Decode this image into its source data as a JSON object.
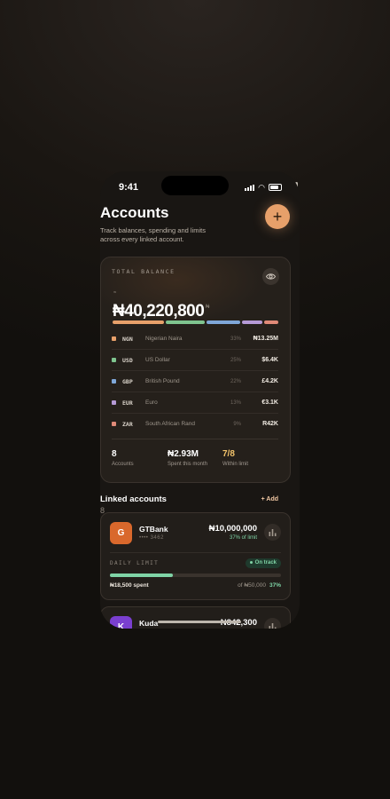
{
  "status": {
    "time": "9:41"
  },
  "header": {
    "title": "Accounts",
    "subtitle": "Track balances, spending and limits across every linked account.",
    "add_symbol": "+"
  },
  "balance_card": {
    "label": "TOTAL BALANCE",
    "small_mark": "≈",
    "amount": "₦40,220,800",
    "ghost_text": "₦",
    "allocation": [
      {
        "code": "NGN",
        "color": "#e7a06a",
        "share": 33
      },
      {
        "code": "USD",
        "color": "#7fc48f",
        "share": 25
      },
      {
        "code": "GBP",
        "color": "#7fa7d8",
        "share": 22
      },
      {
        "code": "EUR",
        "color": "#b59ad6",
        "share": 13
      },
      {
        "code": "ZAR",
        "color": "#e08a78",
        "share": 9
      }
    ],
    "currencies": [
      {
        "code": "NGN",
        "name": "Nigerian Naira",
        "pct": "33%",
        "amount": "₦13.25M",
        "color": "#e7a06a"
      },
      {
        "code": "USD",
        "name": "US Dollar",
        "pct": "25%",
        "amount": "$6.4K",
        "color": "#7fc48f"
      },
      {
        "code": "GBP",
        "name": "British Pound",
        "pct": "22%",
        "amount": "£4.2K",
        "color": "#7fa7d8"
      },
      {
        "code": "EUR",
        "name": "Euro",
        "pct": "13%",
        "amount": "€3.1K",
        "color": "#b59ad6"
      },
      {
        "code": "ZAR",
        "name": "South African Rand",
        "pct": "9%",
        "amount": "R42K",
        "color": "#e08a78"
      }
    ],
    "stats": {
      "accounts_value": "8",
      "accounts_label": "Accounts",
      "spent_value": "₦2.93M",
      "spent_label": "Spent this month",
      "limit_value": "7/8",
      "limit_label": "Within limit"
    }
  },
  "linked": {
    "title": "Linked accounts",
    "sub": "·",
    "count": "8",
    "add_label": "+ Add"
  },
  "accounts": [
    {
      "initial": "G",
      "name": "GTBank",
      "number": "•••• 3462",
      "balance": "₦10,000,000",
      "limit_note": "37% of limit",
      "color": "#d9682c",
      "daily_label": "DAILY LIMIT",
      "status": "On track",
      "spent": "₦18,500 spent",
      "of_limit": "of ₦50,000",
      "pct": "37%",
      "progress": 0.37
    },
    {
      "initial": "K",
      "name": "Kuda",
      "balance": "₦842,300",
      "color": "#7a3fd0"
    }
  ]
}
